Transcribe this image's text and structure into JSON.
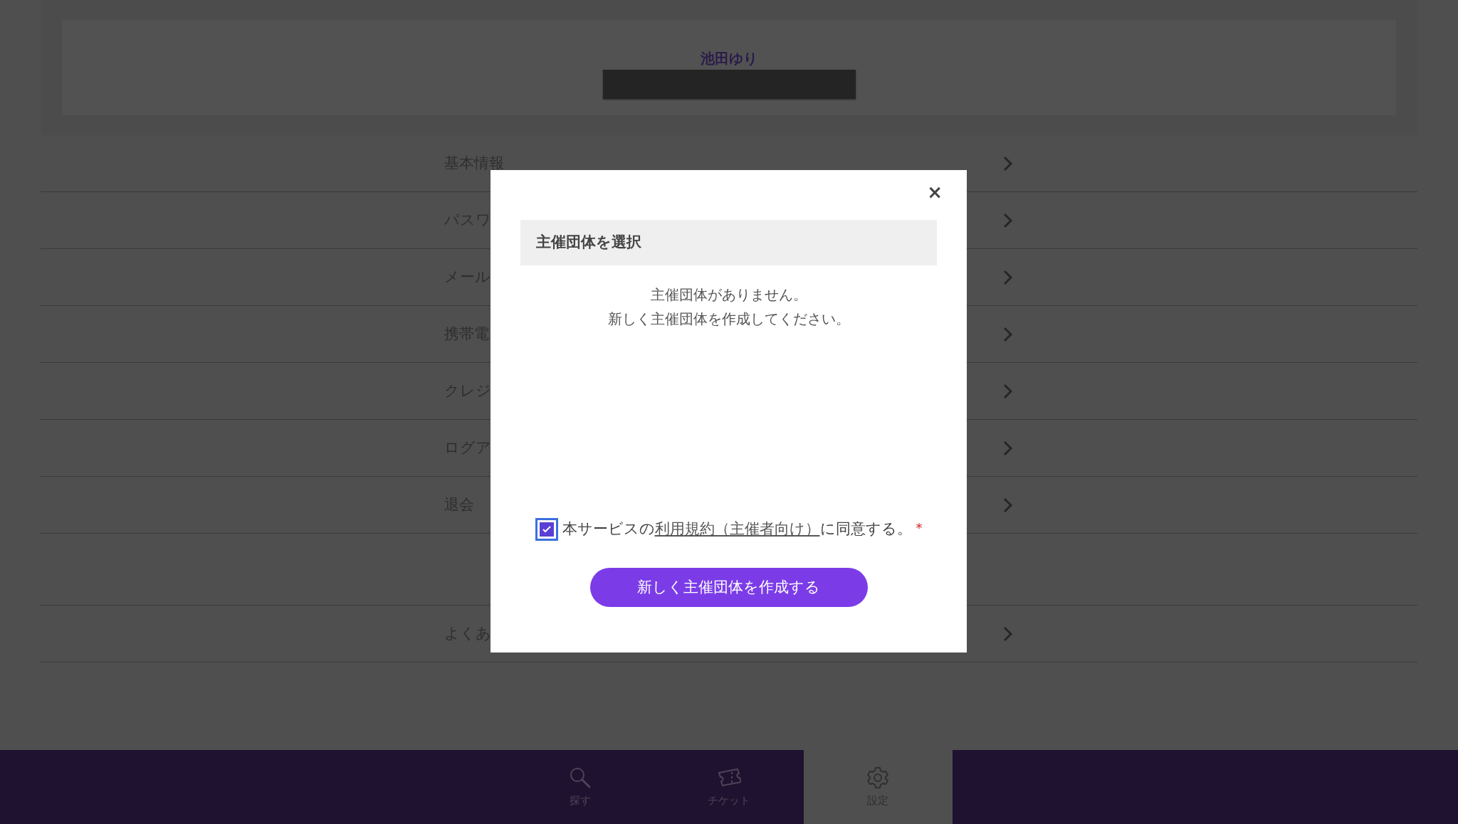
{
  "profile": {
    "name": "池田ゆり"
  },
  "menu_items": [
    {
      "label": "基本情報"
    },
    {
      "label": "パスワ"
    },
    {
      "label": "メール"
    },
    {
      "label": "携帯電"
    },
    {
      "label": "クレジ"
    },
    {
      "label": "ログア"
    },
    {
      "label": "退会"
    }
  ],
  "help_items": [
    {
      "label": "よくあ"
    }
  ],
  "modal": {
    "close": "×",
    "title": "主催団体を選択",
    "message": [
      "主催団体がありません。",
      "新しく主催団体を作成してください。"
    ],
    "agreement": {
      "checked": true,
      "text_before": "本サービスの",
      "link": "利用規約（主催者向け）",
      "text_after": "に同意する。",
      "required_mark": "*"
    },
    "button": "新しく主催団体を作成する"
  },
  "bottom_nav": [
    {
      "label": "探す",
      "kind": "search",
      "selected": false
    },
    {
      "label": "チケット",
      "kind": "ticket",
      "selected": false
    },
    {
      "label": "設定",
      "kind": "settings",
      "selected": true
    }
  ]
}
